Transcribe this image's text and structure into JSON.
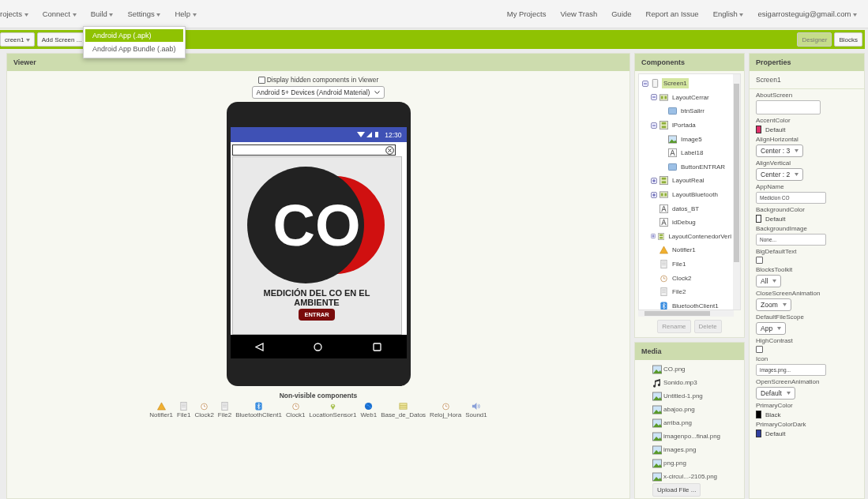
{
  "menu": {
    "left": [
      {
        "label": "rojects"
      },
      {
        "label": "Connect"
      },
      {
        "label": "Build"
      },
      {
        "label": "Settings"
      },
      {
        "label": "Help"
      }
    ],
    "right": [
      {
        "label": "My Projects",
        "dropdown": false
      },
      {
        "label": "View Trash",
        "dropdown": false
      },
      {
        "label": "Guide",
        "dropdown": false
      },
      {
        "label": "Report an Issue",
        "dropdown": false
      },
      {
        "label": "English",
        "dropdown": true
      },
      {
        "label": "esigarrosteguig@gmail.com",
        "dropdown": true
      }
    ]
  },
  "build_menu": [
    {
      "label": "Android App (.apk)",
      "selected": true
    },
    {
      "label": "Android App Bundle (.aab)",
      "selected": false
    }
  ],
  "toolbar": {
    "screen_select": "creen1",
    "add_screen": "Add Screen ...",
    "modes": [
      {
        "label": "Designer",
        "selected": true
      },
      {
        "label": "Blocks",
        "selected": false
      }
    ]
  },
  "viewer": {
    "title": "Viewer",
    "hidden_checkbox": {
      "label": "Display hidden components in Viewer",
      "checked": false
    },
    "device": "Android 5+ Devices (Android Material)",
    "phone": {
      "time": "12:30",
      "logo_text": "CO",
      "heading": "MEDICIÓN DEL CO EN EL AMBIENTE",
      "button": "ENTRAR"
    },
    "nonvisible_title": "Non-visible components",
    "nonvisible": [
      {
        "kind": "notifier",
        "label": "Notifier1"
      },
      {
        "kind": "file",
        "label": "File1"
      },
      {
        "kind": "clock",
        "label": "Clock2"
      },
      {
        "kind": "file",
        "label": "File2"
      },
      {
        "kind": "bluetooth",
        "label": "BluetoothClient1"
      },
      {
        "kind": "clock",
        "label": "Clock1"
      },
      {
        "kind": "location",
        "label": "LocationSensor1"
      },
      {
        "kind": "web",
        "label": "Web1"
      },
      {
        "kind": "database",
        "label": "Base_de_Datos"
      },
      {
        "kind": "clock",
        "label": "Reloj_Hora"
      },
      {
        "kind": "sound",
        "label": "Sound1"
      }
    ]
  },
  "components": {
    "title": "Components",
    "tree": [
      {
        "kind": "screen",
        "label": "Screen1",
        "selected": true,
        "expanded": true,
        "children": [
          {
            "kind": "horizontal",
            "label": "LayoutCerrar",
            "selected": false,
            "expanded": true,
            "children": [
              {
                "kind": "button",
                "label": "btnSalirr",
                "selected": false
              }
            ]
          },
          {
            "kind": "vertical",
            "label": "lPortada",
            "selected": false,
            "expanded": true,
            "children": [
              {
                "kind": "image",
                "label": "Image5",
                "selected": false
              },
              {
                "kind": "label",
                "label": "Label18",
                "selected": false
              },
              {
                "kind": "button",
                "label": "ButtonENTRAR",
                "selected": false
              }
            ]
          },
          {
            "kind": "vertical",
            "label": "LayoutReal",
            "selected": false,
            "expanded": false
          },
          {
            "kind": "horizontal",
            "label": "LayoutBluetooth",
            "selected": false,
            "expanded": false
          },
          {
            "kind": "label",
            "label": "datos_BT",
            "selected": false
          },
          {
            "kind": "label",
            "label": "idDebug",
            "selected": false
          },
          {
            "kind": "vertical",
            "label": "LayoutContenedorVerl",
            "selected": false,
            "expanded": false
          },
          {
            "kind": "notifier",
            "label": "Notifier1",
            "selected": false
          },
          {
            "kind": "file",
            "label": "File1",
            "selected": false
          },
          {
            "kind": "clock",
            "label": "Clock2",
            "selected": false
          },
          {
            "kind": "file",
            "label": "File2",
            "selected": false
          },
          {
            "kind": "bluetooth",
            "label": "BluetoothClient1",
            "selected": false
          }
        ]
      }
    ],
    "buttons": [
      "Rename",
      "Delete"
    ]
  },
  "media": {
    "title": "Media",
    "files": [
      {
        "kind": "image",
        "name": "CO.png"
      },
      {
        "kind": "audio",
        "name": "Sonido.mp3"
      },
      {
        "kind": "image",
        "name": "Untitled-1.png"
      },
      {
        "kind": "image",
        "name": "abajoo.png"
      },
      {
        "kind": "image",
        "name": "arriba.png"
      },
      {
        "kind": "image",
        "name": "imagenpo...final.png"
      },
      {
        "kind": "image",
        "name": "images.png"
      },
      {
        "kind": "image",
        "name": "png.png"
      },
      {
        "kind": "image",
        "name": "x-circul...-2105.png"
      }
    ],
    "upload": "Upload File ..."
  },
  "properties": {
    "title": "Properties",
    "component": "Screen1",
    "items": [
      {
        "kind": "textarea",
        "label": "AboutScreen"
      },
      {
        "kind": "color",
        "label": "AccentColor",
        "value": "Default",
        "color": "#e0306a"
      },
      {
        "kind": "select",
        "label": "AlignHorizontal",
        "value": "Center : 3"
      },
      {
        "kind": "select",
        "label": "AlignVertical",
        "value": "Center : 2"
      },
      {
        "kind": "text",
        "label": "AppName",
        "value": "Medicion CO"
      },
      {
        "kind": "color",
        "label": "BackgroundColor",
        "value": "Default",
        "color": "#ffffff"
      },
      {
        "kind": "text",
        "label": "BackgroundImage",
        "value": "None..."
      },
      {
        "kind": "checkbox",
        "label": "BigDefaultText",
        "checked": false
      },
      {
        "kind": "select",
        "label": "BlocksToolkit",
        "value": "All"
      },
      {
        "kind": "select",
        "label": "CloseScreenAnimation",
        "value": "Zoom"
      },
      {
        "kind": "select",
        "label": "DefaultFileScope",
        "value": "App"
      },
      {
        "kind": "checkbox",
        "label": "HighContrast",
        "checked": false
      },
      {
        "kind": "text",
        "label": "Icon",
        "value": "images.png..."
      },
      {
        "kind": "select",
        "label": "OpenScreenAnimation",
        "value": "Default"
      },
      {
        "kind": "color",
        "label": "PrimaryColor",
        "value": "Black",
        "color": "#000000"
      },
      {
        "kind": "color",
        "label": "PrimaryColorDark",
        "value": "Default",
        "color": "#303f9f"
      }
    ]
  }
}
